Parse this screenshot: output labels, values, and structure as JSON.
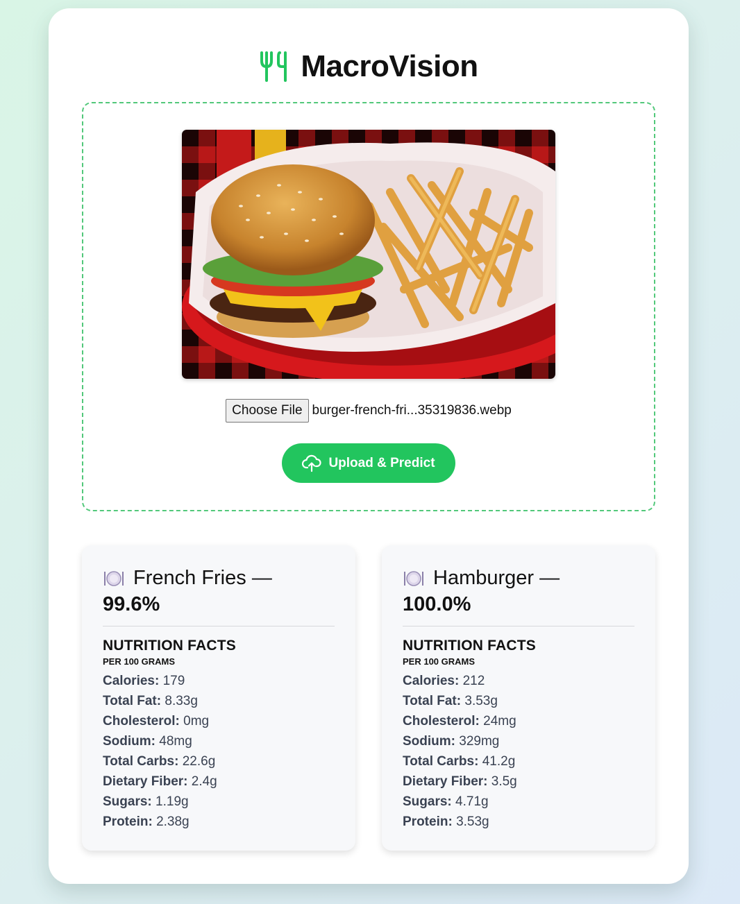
{
  "app": {
    "title": "MacroVision",
    "icon": "fork-knife-icon",
    "accent_color": "#22c55e"
  },
  "upload": {
    "preview_image": "burger-and-fries-photo",
    "choose_file_label": "Choose File",
    "file_name": "burger-french-fri...35319836.webp",
    "button_label": "Upload & Predict",
    "button_icon": "cloud-upload-icon"
  },
  "results": [
    {
      "heading_name": "French Fries —",
      "heading_pct": "99.6%",
      "facts_title": "NUTRITION FACTS",
      "facts_subtitle": "PER 100 GRAMS",
      "facts": [
        {
          "label": "Calories:",
          "value": "179"
        },
        {
          "label": "Total Fat:",
          "value": "8.33g"
        },
        {
          "label": "Cholesterol:",
          "value": "0mg"
        },
        {
          "label": "Sodium:",
          "value": "48mg"
        },
        {
          "label": "Total Carbs:",
          "value": "22.6g"
        },
        {
          "label": "Dietary Fiber:",
          "value": "2.4g"
        },
        {
          "label": "Sugars:",
          "value": "1.19g"
        },
        {
          "label": "Protein:",
          "value": "2.38g"
        }
      ]
    },
    {
      "heading_name": "Hamburger —",
      "heading_pct": "100.0%",
      "facts_title": "NUTRITION FACTS",
      "facts_subtitle": "PER 100 GRAMS",
      "facts": [
        {
          "label": "Calories:",
          "value": "212"
        },
        {
          "label": "Total Fat:",
          "value": "3.53g"
        },
        {
          "label": "Cholesterol:",
          "value": "24mg"
        },
        {
          "label": "Sodium:",
          "value": "329mg"
        },
        {
          "label": "Total Carbs:",
          "value": "41.2g"
        },
        {
          "label": "Dietary Fiber:",
          "value": "3.5g"
        },
        {
          "label": "Sugars:",
          "value": "4.71g"
        },
        {
          "label": "Protein:",
          "value": "3.53g"
        }
      ]
    }
  ]
}
